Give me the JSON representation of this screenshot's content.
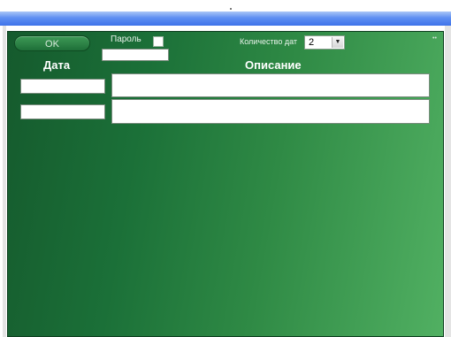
{
  "toolbar": {
    "ok_label": "OK",
    "password_label": "Пароль",
    "password_value": "",
    "date_count_label": "Количество дат",
    "date_count_value": "2"
  },
  "table": {
    "headers": {
      "date": "Дата",
      "description": "Описание"
    },
    "rows": [
      {
        "date": "",
        "description": ""
      },
      {
        "date": "",
        "description": ""
      }
    ]
  },
  "colors": {
    "panel_dark": "#155a2d",
    "panel_light": "#51b062",
    "titlebar": "#5f8ff2"
  },
  "icons": {
    "select_arrow": "chevron-down-icon",
    "password_checkbox": "checkbox-icon"
  }
}
